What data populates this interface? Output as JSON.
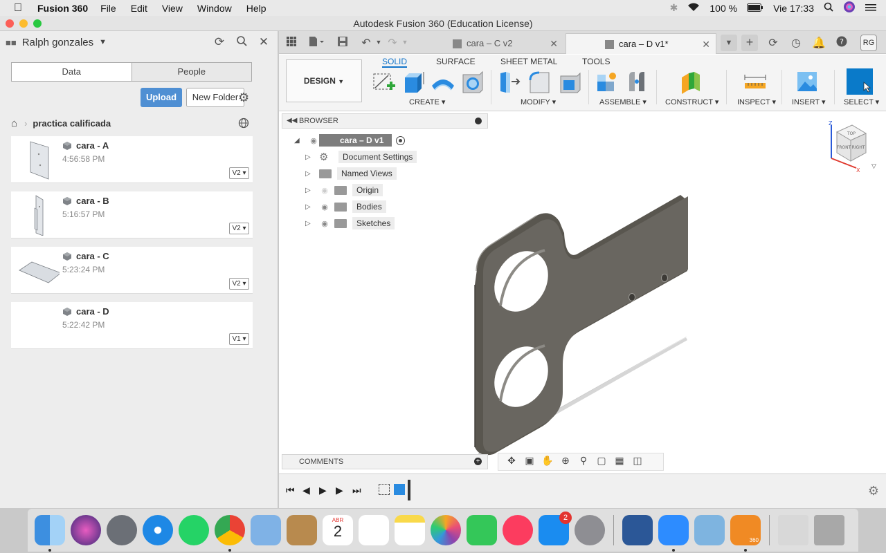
{
  "menubar": {
    "app_name": "Fusion 360",
    "items": [
      "File",
      "Edit",
      "View",
      "Window",
      "Help"
    ],
    "battery": "100 %",
    "clock": "Vie 17:33"
  },
  "window": {
    "title": "Autodesk Fusion 360 (Education License)"
  },
  "data_panel": {
    "user": "Ralph gonzales",
    "tabs": [
      "Data",
      "People"
    ],
    "upload_label": "Upload",
    "new_folder_label": "New Folder",
    "breadcrumb": "practica calificada",
    "files": [
      {
        "name": "cara - A",
        "time": "4:56:58 PM",
        "version": "V2"
      },
      {
        "name": "cara - B",
        "time": "5:16:57 PM",
        "version": "V2"
      },
      {
        "name": "cara - C",
        "time": "5:23:24 PM",
        "version": "V2"
      },
      {
        "name": "cara - D",
        "time": "5:22:42 PM",
        "version": "V1"
      }
    ]
  },
  "tabs": {
    "inactive_doc": "cara – C v2",
    "active_doc": "cara – D v1*",
    "avatar": "RG"
  },
  "ribbon": {
    "workspace": "DESIGN",
    "tabs": [
      "SOLID",
      "SURFACE",
      "SHEET METAL",
      "TOOLS"
    ],
    "groups": [
      "CREATE",
      "MODIFY",
      "ASSEMBLE",
      "CONSTRUCT",
      "INSPECT",
      "INSERT",
      "SELECT"
    ]
  },
  "browser": {
    "title": "BROWSER",
    "root": "cara – D v1",
    "nodes": [
      "Document Settings",
      "Named Views",
      "Origin",
      "Bodies",
      "Sketches"
    ]
  },
  "comments": {
    "title": "COMMENTS"
  },
  "viewcube": {
    "faces": [
      "TOP",
      "FRONT",
      "RIGHT"
    ],
    "axes": [
      "Z",
      "X"
    ]
  },
  "dock": {
    "calendar_month": "ABR",
    "calendar_day": "2",
    "appstore_badge": "2",
    "fusion_label": "360"
  }
}
